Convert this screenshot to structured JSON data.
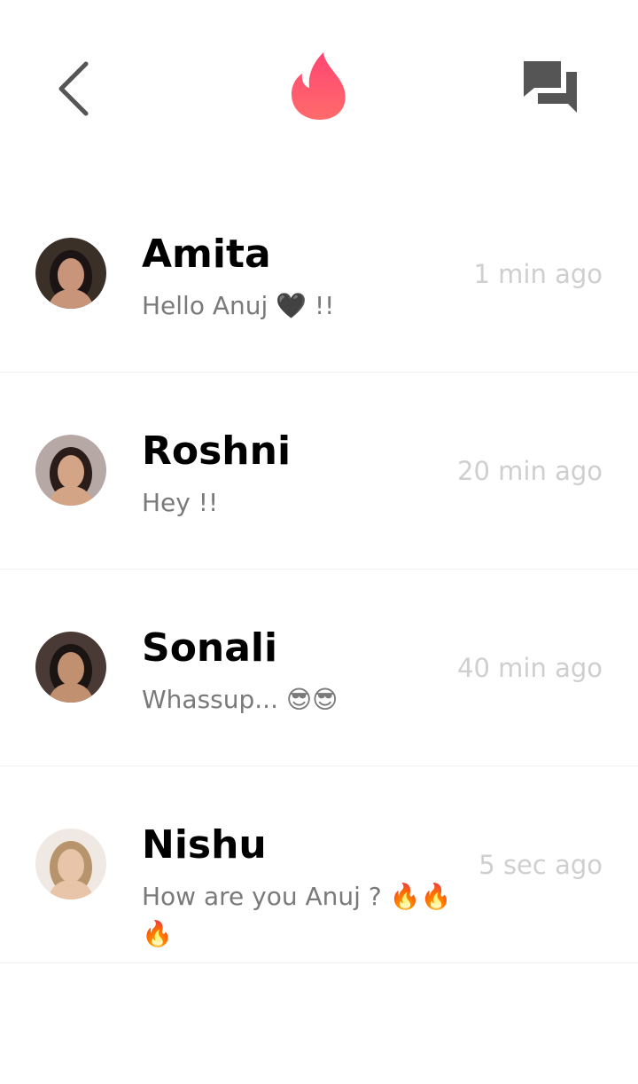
{
  "header": {
    "back_icon": "chevron-left-icon",
    "logo_icon": "flame-logo-icon",
    "chat_icon": "chat-bubbles-icon",
    "logo_gradient": [
      "#ff6b6b",
      "#ff4572"
    ],
    "icon_color": "#555555"
  },
  "conversations": [
    {
      "name": "Amita",
      "message": "Hello Anuj 🖤 !!",
      "time": "1 min ago",
      "avatar": {
        "skin": "#c9957a",
        "hair": "#1c1414",
        "bg": "#3a3028"
      }
    },
    {
      "name": "Roshni",
      "message": "Hey !!",
      "time": "20 min ago",
      "avatar": {
        "skin": "#d4a487",
        "hair": "#2a1c18",
        "bg": "#b6a8a4"
      }
    },
    {
      "name": "Sonali",
      "message": "Whassup... 😎😎",
      "time": "40 min ago",
      "avatar": {
        "skin": "#c09070",
        "hair": "#1a1412",
        "bg": "#4a3a36"
      }
    },
    {
      "name": "Nishu",
      "message": "How are you Anuj ? 🔥🔥🔥",
      "time": "5 sec ago",
      "avatar": {
        "skin": "#e8c4a8",
        "hair": "#b8946c",
        "bg": "#f0e8e2"
      }
    }
  ]
}
